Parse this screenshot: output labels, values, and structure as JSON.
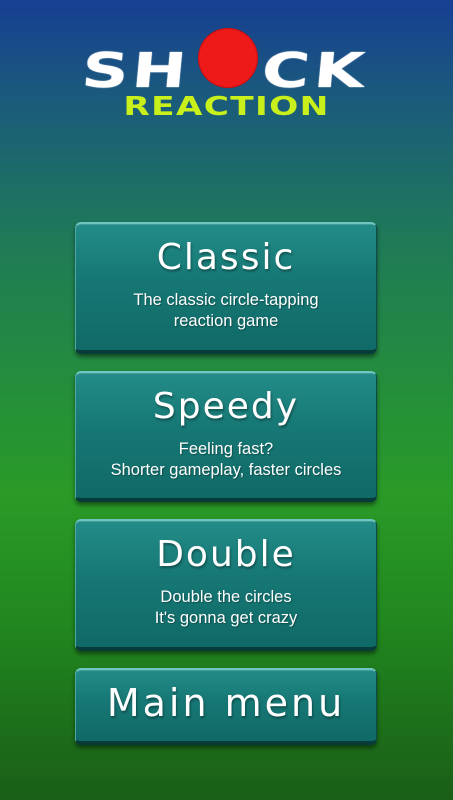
{
  "logo": {
    "shock_text": "SHOCK",
    "shock_letters": [
      "S",
      "H",
      "C",
      "K"
    ],
    "reaction_text": "REACTION",
    "dot_color": "#ee1a1a",
    "reaction_color": "#c9f01a"
  },
  "menu": {
    "classic": {
      "title": "Classic",
      "desc_line1": "The classic circle-tapping",
      "desc_line2": "reaction game"
    },
    "speedy": {
      "title": "Speedy",
      "desc_line1": "Feeling fast?",
      "desc_line2": "Shorter gameplay, faster circles"
    },
    "double": {
      "title": "Double",
      "desc_line1": "Double the circles",
      "desc_line2": "It's gonna get crazy"
    },
    "main_menu": {
      "title": "Main menu"
    }
  },
  "colors": {
    "button_face": "#167774",
    "bg_top": "#173f93",
    "bg_bottom": "#1a5e17"
  }
}
